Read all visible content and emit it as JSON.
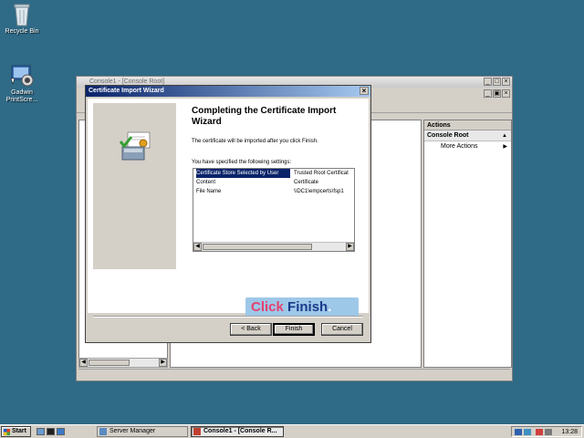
{
  "desktop": {
    "icons": [
      {
        "label": "Recycle Bin",
        "icon": "recycle-bin-icon"
      },
      {
        "label": "Gadwin PrintScre...",
        "icon": "gadwin-printscreen-icon"
      }
    ]
  },
  "mmc": {
    "title": "Console1 - [Console Root]",
    "window_controls": [
      "_",
      "□",
      "×"
    ],
    "inner_controls": [
      "_",
      "▣",
      "×"
    ],
    "actions": {
      "header": "Actions",
      "section": "Console Root",
      "items": [
        "More Actions"
      ]
    }
  },
  "wizard": {
    "title": "Certificate Import Wizard",
    "heading": "Completing the Certificate Import Wizard",
    "intro": "The certificate will be imported after you click Finish.",
    "settings_label": "You have specified the following settings:",
    "settings": [
      {
        "name": "Certificate Store Selected by User",
        "value": "Trusted Root Certificat"
      },
      {
        "name": "Content",
        "value": "Certificate"
      },
      {
        "name": "File Name",
        "value": "\\\\DC1\\empcerts\\fsp1"
      }
    ],
    "buttons": {
      "back": "< Back",
      "finish": "Finish",
      "cancel": "Cancel"
    },
    "close": "×"
  },
  "callout": {
    "part1": "Click",
    "part2": "Finish",
    "part3": "."
  },
  "taskbar": {
    "start": "Start",
    "tasks": [
      {
        "label": "Server Manager",
        "active": false
      },
      {
        "label": "Console1 - [Console R...",
        "active": true
      }
    ],
    "clock": "13:28"
  }
}
